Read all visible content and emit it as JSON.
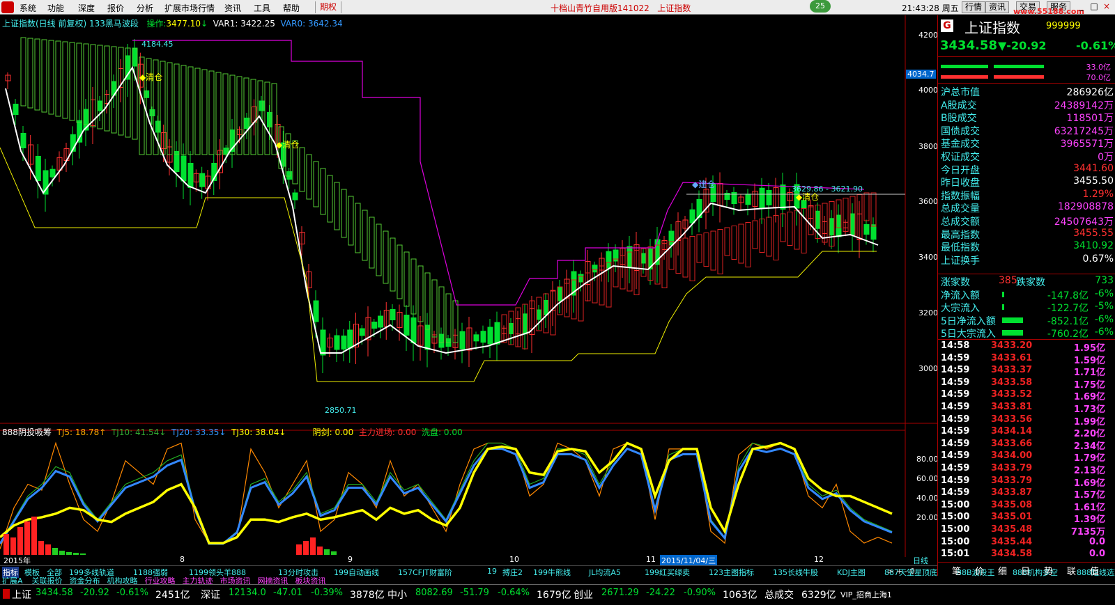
{
  "menu": {
    "items": [
      "系统",
      "功能",
      "深度",
      "报价",
      "分析",
      "扩展市场行情",
      "资讯",
      "工具",
      "帮助"
    ],
    "highlight": "期权",
    "title": "十档山青竹自用版141022",
    "title2": "上证指数",
    "badge": "25",
    "clock": "21:43:28 周五",
    "right_buttons": [
      "行情",
      "资讯",
      "交易",
      "服务"
    ],
    "url": "www.55188.com"
  },
  "main_header": {
    "name": "上证指数(日线 前复权) 133黑马波段",
    "op_label": "操作:",
    "op_val": "3477.10",
    "var1": "VAR1: 3422.25",
    "var0": "VAR0: 3642.34"
  },
  "annotations": {
    "high": "4184.45",
    "low": "2850.71",
    "clear1": "◆清仓",
    "clear2": "◆清仓",
    "clear3": "◆清仓",
    "build": "◆建仓",
    "range": "3629.86 - 3621.90"
  },
  "price_axis": [
    "4200",
    "4000",
    "3800",
    "3600",
    "3400",
    "3200",
    "3000"
  ],
  "price_marker": "4034.7",
  "sub_header": {
    "name": "888阴投吸筹",
    "tj5": "TJ5: 18.78↑",
    "tj10": "TJ10: 41.54↓",
    "tj20": "TJ20: 33.35↓",
    "tj30": "TJ30: 38.04↓",
    "yj": "阴剑: 0.00",
    "zl": "主力进场: 0.00",
    "xp": "洗盘: 0.00"
  },
  "sub_axis": [
    "80.00",
    "60.00",
    "40.00",
    "20.00"
  ],
  "x_axis": {
    "labels": [
      "2015年",
      "8",
      "9",
      "10",
      "11",
      "12"
    ],
    "cursor": "2015/11/04/三",
    "period": "日线"
  },
  "indicator_tabs": [
    "指标",
    "模板",
    "全部",
    "199多线轨道",
    "1188强弱",
    "1199领头羊888",
    "13分时攻击",
    "199自动画线",
    "157CFJT财富阶",
    "19",
    "搏庄2",
    "199牛熊线",
    "JL均流A5",
    "199红买绿卖",
    "123主图指标",
    "135长线牛股",
    "KDJ主图",
    "887天堂星顶底",
    "88B波段王",
    "888机构多空",
    "888短线选顶"
  ],
  "indicator_tabs2": [
    "扩展A",
    "关联报价",
    "资金分布",
    "机构攻略",
    "行业攻略",
    "主力轨迹",
    "市场资讯",
    "网摘资讯",
    "板块资讯"
  ],
  "indicator_extra": "> + - 0",
  "quote": {
    "logo": "G",
    "name": "上证指数",
    "code": "999999",
    "price": "3434.58",
    "change": "▼-20.92",
    "pct": "-0.61%",
    "bar1": "33.0亿",
    "bar2": "70.0亿"
  },
  "stats": [
    {
      "k": "沪总市值",
      "v": "286926亿",
      "c": "#fff"
    },
    {
      "k": "A股成交",
      "v": "24389142万",
      "c": "#f4f"
    },
    {
      "k": "B股成交",
      "v": "118501万",
      "c": "#f4f"
    },
    {
      "k": "国债成交",
      "v": "63217245万",
      "c": "#f4f"
    },
    {
      "k": "基金成交",
      "v": "3965571万",
      "c": "#f4f"
    },
    {
      "k": "权证成交",
      "v": "0万",
      "c": "#f4f"
    },
    {
      "k": "今日开盘",
      "v": "3441.60",
      "c": "#ff3030"
    },
    {
      "k": "昨日收盘",
      "v": "3455.50",
      "c": "#fff"
    },
    {
      "k": "指数振幅",
      "v": "1.29%",
      "c": "#ff3030"
    },
    {
      "k": "总成交量",
      "v": "182908878",
      "c": "#f4f"
    },
    {
      "k": "总成交额",
      "v": "24507643万",
      "c": "#f4f"
    },
    {
      "k": "最高指数",
      "v": "3455.55",
      "c": "#ff3030"
    },
    {
      "k": "最低指数",
      "v": "3410.92",
      "c": "#00e030"
    },
    {
      "k": "上证换手",
      "v": "0.67%",
      "c": "#fff"
    }
  ],
  "updown": {
    "k1": "涨家数",
    "v1": "385",
    "k2": "跌家数",
    "v2": "733"
  },
  "flows": [
    {
      "k": "净流入额",
      "v": "-147.8亿",
      "p": "-6%",
      "bar": 0.03
    },
    {
      "k": "大宗流入",
      "v": "-122.7亿",
      "p": "-5%",
      "bar": 0.02
    },
    {
      "k": "5日净流入额",
      "v": "-852.1亿",
      "p": "-6%",
      "bar": 1
    },
    {
      "k": "5日大宗流入",
      "v": "-760.2亿",
      "p": "-6%",
      "bar": 1
    }
  ],
  "ticks": [
    {
      "t": "14:58",
      "p": "3433.20",
      "q": "1.95亿",
      "d": ""
    },
    {
      "t": "14:59",
      "p": "3433.61",
      "q": "1.59亿",
      "d": ""
    },
    {
      "t": "14:59",
      "p": "3433.37",
      "q": "1.71亿",
      "d": ""
    },
    {
      "t": "14:59",
      "p": "3433.58",
      "q": "1.75亿",
      "d": ""
    },
    {
      "t": "14:59",
      "p": "3433.52",
      "q": "1.69亿",
      "d": ""
    },
    {
      "t": "14:59",
      "p": "3433.81",
      "q": "1.73亿",
      "d": ""
    },
    {
      "t": "14:59",
      "p": "3433.56",
      "q": "1.99亿",
      "d": ""
    },
    {
      "t": "14:59",
      "p": "3434.14",
      "q": "2.20亿",
      "d": ""
    },
    {
      "t": "14:59",
      "p": "3433.66",
      "q": "2.34亿",
      "d": ""
    },
    {
      "t": "14:59",
      "p": "3434.00",
      "q": "1.79亿",
      "d": ""
    },
    {
      "t": "14:59",
      "p": "3433.79",
      "q": "2.13亿",
      "d": ""
    },
    {
      "t": "14:59",
      "p": "3433.79",
      "q": "1.69亿",
      "d": ""
    },
    {
      "t": "14:59",
      "p": "3433.87",
      "q": "1.57亿",
      "d": ""
    },
    {
      "t": "15:00",
      "p": "3435.08",
      "q": "1.61亿",
      "d": ""
    },
    {
      "t": "15:00",
      "p": "3435.01",
      "q": "1.39亿",
      "d": ""
    },
    {
      "t": "15:00",
      "p": "3435.48",
      "q": "7135万",
      "d": ""
    },
    {
      "t": "15:00",
      "p": "3435.44",
      "q": "0.0",
      "d": ""
    },
    {
      "t": "15:01",
      "p": "3434.58",
      "q": "0.0",
      "d": ""
    }
  ],
  "right_tabs": [
    "笔",
    "价",
    "细",
    "日",
    "势",
    "联",
    "值"
  ],
  "statusbar": [
    {
      "n": "上证",
      "p": "3434.58",
      "c": "-20.92",
      "pc": "-0.61%",
      "a": "2451亿"
    },
    {
      "n": "深证",
      "p": "12134.0",
      "c": "-47.01",
      "pc": "-0.39%",
      "a": "3878亿"
    },
    {
      "n": "中小",
      "p": "8082.69",
      "c": "-51.79",
      "pc": "-0.64%",
      "a": "1679亿"
    },
    {
      "n": "创业",
      "p": "2671.29",
      "c": "-24.22",
      "pc": "-0.90%",
      "a": "1063亿"
    }
  ],
  "status_total": {
    "k": "总成交",
    "v": "6329亿"
  },
  "status_server": "VIP_招商上海1"
}
